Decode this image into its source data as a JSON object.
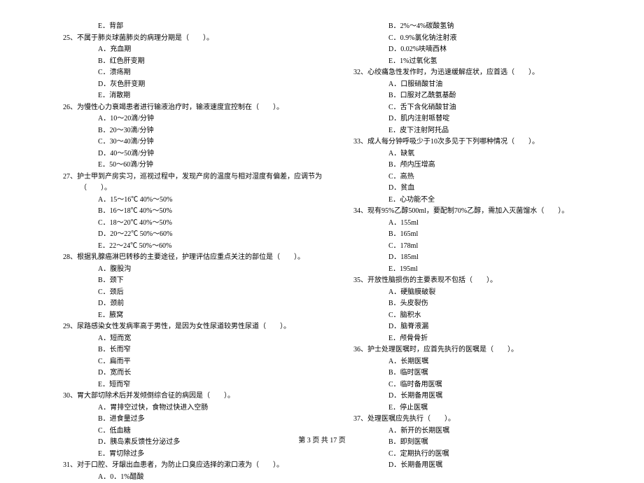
{
  "left": {
    "pre_option": "E．背部",
    "q25": {
      "stem": "25、不属于肺炎球菌肺炎的病理分期是（　　）。",
      "opts": [
        "A．充血期",
        "B．红色肝变期",
        "C．溃疡期",
        "D．灰色肝变期",
        "E．消散期"
      ]
    },
    "q26": {
      "stem": "26、为慢性心力衰竭患者进行输液治疗时，输液速度宜控制在（　　）。",
      "opts": [
        "A．10～20滴/分钟",
        "B．20～30滴/分钟",
        "C．30～40滴/分钟",
        "D．40～50滴/分钟",
        "E．50～60滴/分钟"
      ]
    },
    "q27": {
      "stem": "27、护士甲到产房实习，巡视过程中，发现产房的温度与相对湿度有偏差，应调节为（　　）。",
      "opts": [
        "A．15～16℃ 40%～50%",
        "B．16～18℃ 40%～50%",
        "C．18～20℃ 40%～50%",
        "D．20～22℃ 50%～60%",
        "E．22～24℃ 50%～60%"
      ]
    },
    "q28": {
      "stem": "28、根据乳腺癌淋巴转移的主要途径，护理评估应重点关注的部位是（　　）。",
      "opts": [
        "A．腹股沟",
        "B．颈下",
        "C．颈后",
        "D．颈前",
        "E．腋窝"
      ]
    },
    "q29": {
      "stem": "29、尿路感染女性发病率高于男性，是因为女性尿道较男性尿道（　　）。",
      "opts": [
        "A．短而宽",
        "B．长而窄",
        "C．扁而平",
        "D．宽而长",
        "E．短而窄"
      ]
    },
    "q30": {
      "stem": "30、胃大部切除术后并发倾倒综合征的病因是（　　）。",
      "opts": [
        "A．胃排空过快，食物过快进入空肠",
        "B．进食量过多",
        "C．低血糖",
        "D．胰岛素反馈性分泌过多",
        "E．胃切除过多"
      ]
    },
    "q31": {
      "stem": "31、对于口腔、牙龈出血患者，为防止口臭应选择的漱口液为（　　）。",
      "opts": [
        "A．0．1%醋酸"
      ]
    }
  },
  "right": {
    "pre_opts": [
      "B．2%～4%碳酸氢钠",
      "C．0.9%氯化钠注射液",
      "D．0.02%呋喃西林",
      "E．1%过氧化氢"
    ],
    "q32": {
      "stem": "32、心绞痛急性发作时，为迅速缓解症状，应首选（　　）。",
      "opts": [
        "A．口服硝酸甘油",
        "B．口服对乙酰氨基酚",
        "C．舌下含化硝酸甘油",
        "D．肌内注射哌替啶",
        "E．皮下注射阿托品"
      ]
    },
    "q33": {
      "stem": "33、成人每分钟呼吸少于10次多见于下列哪种情况（　　）。",
      "opts": [
        "A．缺氧",
        "B．颅内压增高",
        "C．高热",
        "D．贫血",
        "E．心功能不全"
      ]
    },
    "q34": {
      "stem": "34、现有95%乙醇500ml，要配制70%乙醇，需加入灭菌馏水（　　）。",
      "opts": [
        "A．155ml",
        "B．165ml",
        "C．178ml",
        "D．185ml",
        "E．195ml"
      ]
    },
    "q35": {
      "stem": "35、开放性脑损伤的主要表现不包括（　　）。",
      "opts": [
        "A．硬脑膜破裂",
        "B．头皮裂伤",
        "C．脑积水",
        "D．脑脊液漏",
        "E．颅骨骨折"
      ]
    },
    "q36": {
      "stem": "36、护士处理医嘱时，应首先执行的医嘱是（　　）。",
      "opts": [
        "A．长期医嘱",
        "B．临时医嘱",
        "C．临时备用医嘱",
        "D．长期备用医嘱",
        "E．停止医嘱"
      ]
    },
    "q37": {
      "stem": "37、处理医嘱应先执行（　　）。",
      "opts": [
        "A．新开的长期医嘱",
        "B．即刻医嘱",
        "C．定期执行的医嘱",
        "D．长期备用医嘱"
      ]
    }
  },
  "footer": "第 3 页 共 17 页"
}
